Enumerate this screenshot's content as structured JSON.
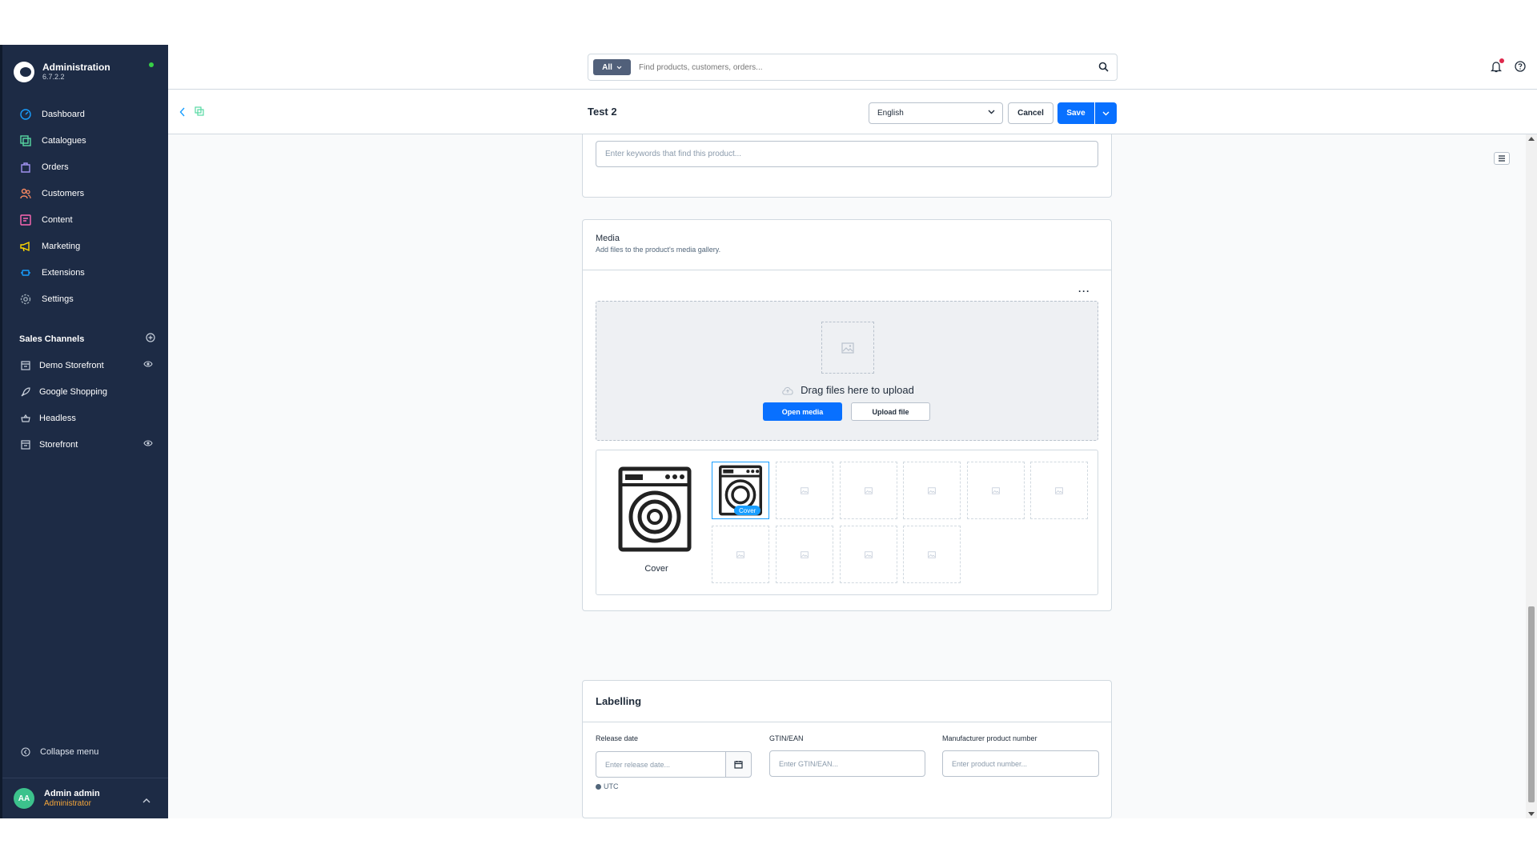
{
  "brand": {
    "title": "Administration",
    "version": "6.7.2.2",
    "status_color": "#37d046"
  },
  "nav": [
    {
      "label": "Dashboard",
      "icon": "dashboard-icon",
      "color": "#189eff"
    },
    {
      "label": "Catalogues",
      "icon": "catalogue-icon",
      "color": "#57d9a3"
    },
    {
      "label": "Orders",
      "icon": "orders-icon",
      "color": "#a092f0"
    },
    {
      "label": "Customers",
      "icon": "customers-icon",
      "color": "#f88962"
    },
    {
      "label": "Content",
      "icon": "content-icon",
      "color": "#ff68b4"
    },
    {
      "label": "Marketing",
      "icon": "marketing-icon",
      "color": "#ffd700"
    },
    {
      "label": "Extensions",
      "icon": "extensions-icon",
      "color": "#189eff"
    },
    {
      "label": "Settings",
      "icon": "settings-icon",
      "color": "#9aa8b5"
    }
  ],
  "sales_channels": {
    "title": "Sales Channels",
    "items": [
      {
        "label": "Demo Storefront",
        "icon": "storefront-icon",
        "visible_toggle": true
      },
      {
        "label": "Google Shopping",
        "icon": "rocket-icon",
        "visible_toggle": false
      },
      {
        "label": "Headless",
        "icon": "basket-icon",
        "visible_toggle": false
      },
      {
        "label": "Storefront",
        "icon": "storefront-icon",
        "visible_toggle": true
      }
    ]
  },
  "collapse_label": "Collapse menu",
  "user": {
    "initials": "AA",
    "name": "Admin admin",
    "role": "Administrator"
  },
  "search": {
    "filter": "All",
    "placeholder": "Find products, customers, orders..."
  },
  "smartbar": {
    "title": "Test 2",
    "language": "English",
    "cancel": "Cancel",
    "save": "Save"
  },
  "keywords": {
    "placeholder": "Enter keywords that find this product..."
  },
  "media": {
    "title": "Media",
    "subtitle": "Add files to the product's media gallery.",
    "dropzone_text": "Drag files here to upload",
    "open_media": "Open media",
    "upload_file": "Upload file",
    "cover_label": "Cover",
    "cover_badge": "Cover"
  },
  "labelling": {
    "title": "Labelling",
    "release_date_label": "Release date",
    "release_date_placeholder": "Enter release date...",
    "timezone": "UTC",
    "gtin_label": "GTIN/EAN",
    "gtin_placeholder": "Enter GTIN/EAN...",
    "mpn_label": "Manufacturer product number",
    "mpn_placeholder": "Enter product number..."
  },
  "colors": {
    "primary": "#0870ff",
    "sidebar": "#1d2b45",
    "accent": "#189eff"
  }
}
